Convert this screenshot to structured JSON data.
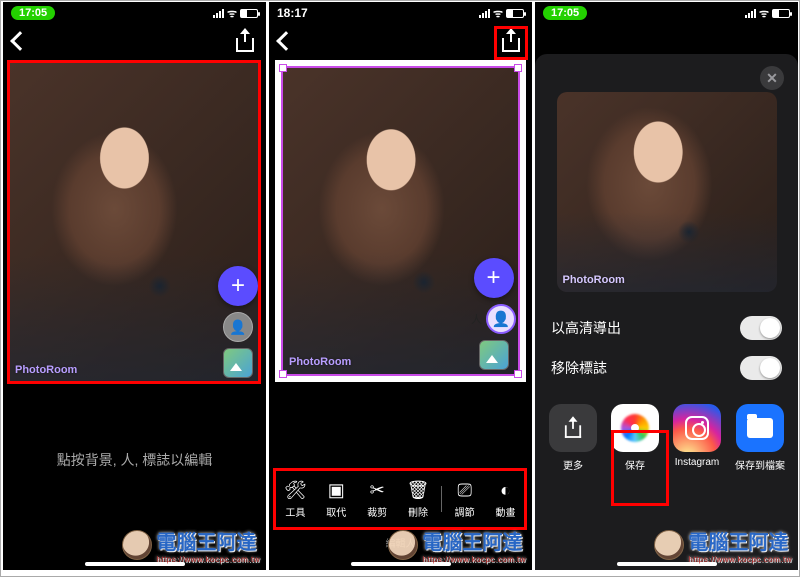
{
  "status": {
    "time_green": "17:05",
    "time_plain": "18:17"
  },
  "nav": {
    "back": "返回",
    "share": "分享"
  },
  "app_watermark": "PhotoRoom",
  "screen1": {
    "hint": "點按背景, 人, 標誌以編輯"
  },
  "screen2": {
    "layer_person_label": "人",
    "toolbar": [
      {
        "key": "tools",
        "label": "工具",
        "icon": "✕⚙"
      },
      {
        "key": "replace",
        "label": "取代",
        "icon": "▣"
      },
      {
        "key": "crop",
        "label": "裁剪",
        "icon": "✂"
      },
      {
        "key": "delete",
        "label": "刪除",
        "icon": "🗑"
      },
      {
        "key": "adjust",
        "label": "調節",
        "icon": "⎚"
      },
      {
        "key": "animate",
        "label": "動畫",
        "icon": "◐"
      }
    ],
    "bottom_caption": "編輯人"
  },
  "screen3": {
    "close": "關閉",
    "options": {
      "hd_export": "以高清導出",
      "remove_logo": "移除標誌"
    },
    "share_targets": [
      {
        "key": "more",
        "label": "更多"
      },
      {
        "key": "save",
        "label": "保存"
      },
      {
        "key": "instagram",
        "label": "Instagram"
      },
      {
        "key": "files",
        "label": "保存到檔案"
      }
    ]
  },
  "site_watermark": {
    "name": "電腦王阿達",
    "url": "https://www.kocpc.com.tw"
  }
}
